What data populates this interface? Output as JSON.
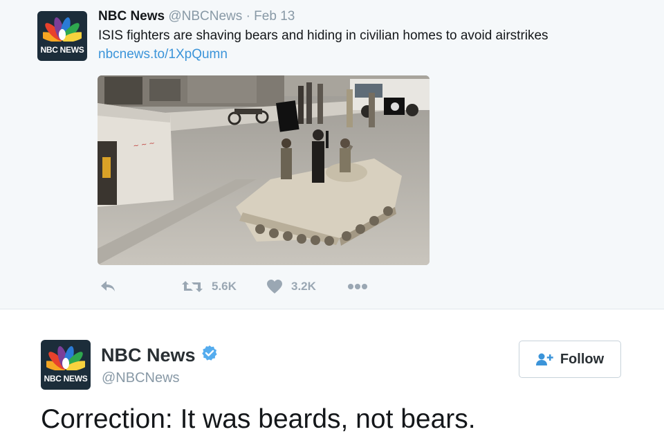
{
  "tweet": {
    "author_name": "NBC News",
    "author_handle": "@NBCNews",
    "separator": "·",
    "date": "Feb 13",
    "text": "ISIS fighters are shaving bears and hiding in civilian homes to avoid airstrikes",
    "link": "nbcnews.to/1XpQumn",
    "avatar_label": "NBC NEWS",
    "actions": {
      "reply_icon": "reply-icon",
      "retweet_icon": "retweet-icon",
      "retweet_count": "5.6K",
      "like_icon": "heart-icon",
      "like_count": "3.2K",
      "more_icon": "more-dots-icon"
    }
  },
  "follow_card": {
    "author_name": "NBC News",
    "author_handle": "@NBCNews",
    "verified_icon": "verified-badge-icon",
    "avatar_label": "NBC NEWS",
    "follow_label": "Follow",
    "follow_icon": "add-user-icon",
    "text": "Correction: It was beards, not bears."
  },
  "colors": {
    "accent_blue": "#3b94d9",
    "muted_text": "#8899a6",
    "tweet_bg": "#f5f8fa",
    "avatar_bg": "#1c2d3a"
  }
}
